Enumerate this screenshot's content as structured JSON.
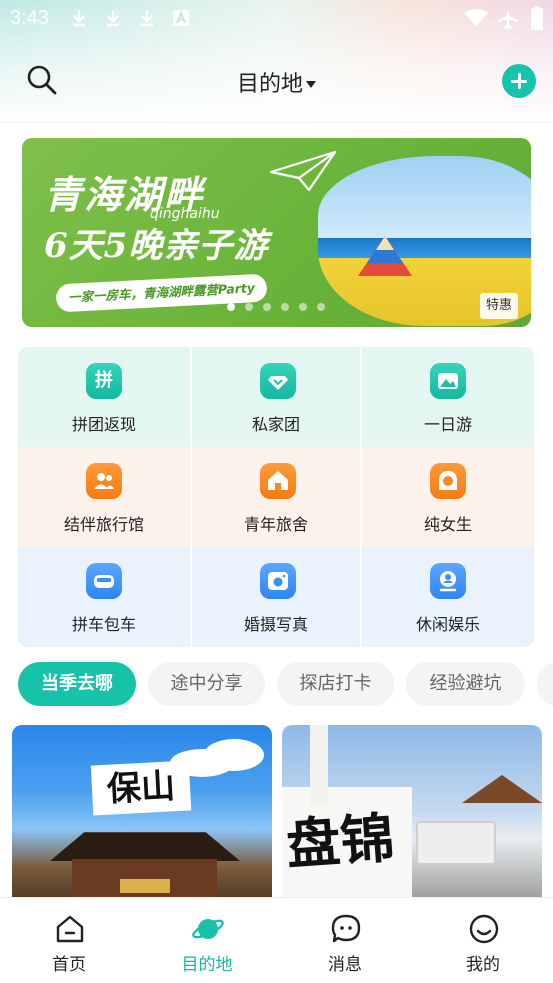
{
  "status_bar": {
    "time": "3:43",
    "notification_icons": [
      "download-icon",
      "download-icon",
      "download-icon",
      "font-a-icon"
    ],
    "system_icons": [
      "wifi-icon",
      "airplane-mode-icon",
      "battery-icon"
    ]
  },
  "header": {
    "title": "目的地",
    "search_icon": "search-icon",
    "dropdown_icon": "caret-down-icon",
    "add_icon": "plus-icon"
  },
  "banner": {
    "headline_1": "青海湖畔",
    "pinyin": "qinghaihu",
    "headline_2": "6天5晚亲子游",
    "ribbon_text": "一家一房车，青海湖畔露营Party",
    "tag": "特惠",
    "slide_count": 6,
    "active_slide": 1
  },
  "categories": [
    [
      {
        "label": "拼团返现",
        "icon": "pin-icon",
        "glyph": "拼",
        "color": "teal"
      },
      {
        "label": "私家团",
        "icon": "diamond-icon",
        "glyph": "",
        "color": "teal"
      },
      {
        "label": "一日游",
        "icon": "mountain-icon",
        "glyph": "",
        "color": "teal"
      }
    ],
    [
      {
        "label": "结伴旅行馆",
        "icon": "companions-icon",
        "glyph": "",
        "color": "orange"
      },
      {
        "label": "青年旅舍",
        "icon": "house-icon",
        "glyph": "",
        "color": "orange"
      },
      {
        "label": "纯女生",
        "icon": "woman-icon",
        "glyph": "",
        "color": "orange"
      }
    ],
    [
      {
        "label": "拼车包车",
        "icon": "car-icon",
        "glyph": "",
        "color": "blue"
      },
      {
        "label": "婚摄写真",
        "icon": "camera-icon",
        "glyph": "",
        "color": "blue"
      },
      {
        "label": "休闲娱乐",
        "icon": "location-person-icon",
        "glyph": "",
        "color": "blue"
      }
    ]
  ],
  "tabs": [
    {
      "label": "当季去哪",
      "active": true
    },
    {
      "label": "途中分享",
      "active": false
    },
    {
      "label": "探店打卡",
      "active": false
    },
    {
      "label": "经验避坑",
      "active": false
    }
  ],
  "feed": [
    {
      "caption": "保山"
    },
    {
      "caption": "盘锦"
    }
  ],
  "bottom_nav": [
    {
      "label": "首页",
      "icon": "home-icon",
      "active": false
    },
    {
      "label": "目的地",
      "icon": "planet-icon",
      "active": true
    },
    {
      "label": "消息",
      "icon": "message-icon",
      "active": false
    },
    {
      "label": "我的",
      "icon": "smile-profile-icon",
      "active": false
    }
  ],
  "colors": {
    "accent": "#16c2a8",
    "teal_row_bg": "#e4f6f1",
    "orange_row_bg": "#fdf1ec",
    "blue_row_bg": "#eaf2fd",
    "banner_green": "#6ab43a"
  }
}
